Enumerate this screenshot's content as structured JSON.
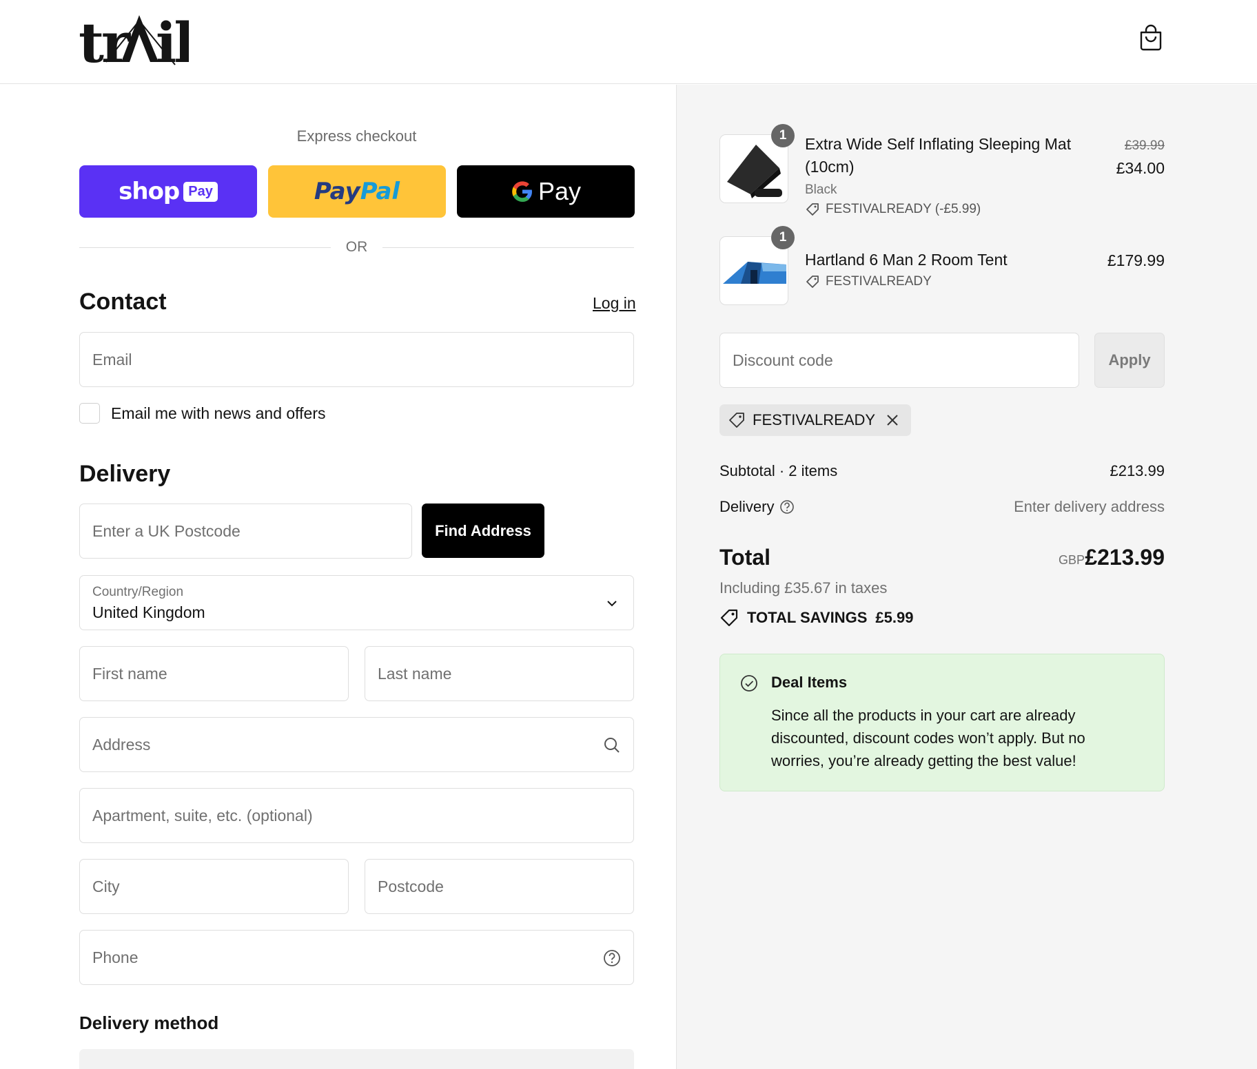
{
  "brand": {
    "logo_text": "tr il"
  },
  "express": {
    "title": "Express checkout",
    "shop_word": "shop",
    "shop_pay": "Pay",
    "paypal_p1": "Pay",
    "paypal_p2": "Pal",
    "gpay_label": "Pay",
    "or_label": "OR"
  },
  "contact": {
    "title": "Contact",
    "login_label": "Log in",
    "email_placeholder": "Email",
    "newsletter_label": "Email me with news and offers"
  },
  "delivery": {
    "title": "Delivery",
    "postcode_lookup_placeholder": "Enter a UK Postcode",
    "find_address_label": "Find Address",
    "country_label": "Country/Region",
    "country_value": "United Kingdom",
    "first_name_placeholder": "First name",
    "last_name_placeholder": "Last name",
    "address_placeholder": "Address",
    "apartment_placeholder": "Apartment, suite, etc. (optional)",
    "city_placeholder": "City",
    "postcode_placeholder": "Postcode",
    "phone_placeholder": "Phone",
    "method_title": "Delivery method"
  },
  "cart": {
    "items": [
      {
        "title_line1": "Extra Wide Self Inflating Sleeping Mat",
        "title_line2": "(10cm)",
        "variant": "Black",
        "code": "FESTIVALREADY (-£5.99)",
        "price_old": "£39.99",
        "price": "£34.00",
        "qty": "1"
      },
      {
        "title_line1": "Hartland 6 Man 2 Room Tent",
        "code": "FESTIVALREADY",
        "price": "£179.99",
        "qty": "1"
      }
    ]
  },
  "discount": {
    "placeholder": "Discount code",
    "apply_label": "Apply",
    "applied_code": "FESTIVALREADY"
  },
  "summary": {
    "subtotal_label": "Subtotal · 2 items",
    "subtotal_value": "£213.99",
    "delivery_label": "Delivery",
    "delivery_value": "Enter delivery address",
    "total_label": "Total",
    "currency": "GBP",
    "total_value": "£213.99",
    "tax_line": "Including £35.67 in taxes",
    "savings_label": "TOTAL SAVINGS",
    "savings_value": "£5.99"
  },
  "deal": {
    "title": "Deal Items",
    "body": "Since all the products in your cart are already discounted, discount codes won’t apply. But no worries, you’re already getting the best value!"
  },
  "colors": {
    "shop_pay": "#5a31f4",
    "paypal": "#ffc439",
    "gpay": "#000000",
    "deal_bg": "#e3f6e0",
    "summary_bg": "#f5f5f5"
  }
}
